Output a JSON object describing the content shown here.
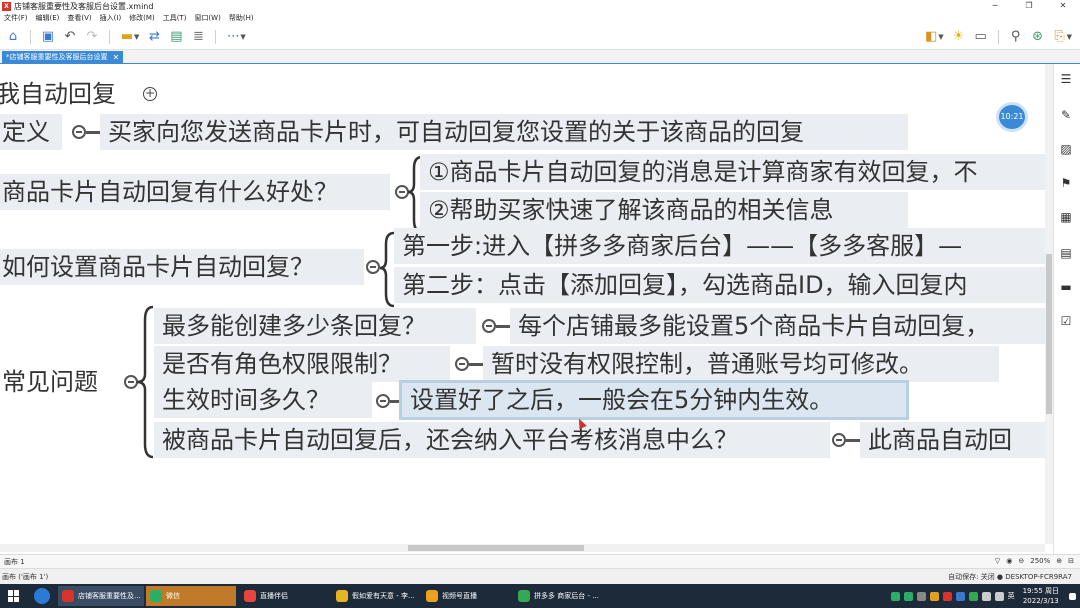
{
  "window": {
    "title": "店铺客服重要性及客服后台设置.xmind",
    "logo": "X",
    "controls": [
      "─",
      "❐",
      "✕"
    ]
  },
  "menu": [
    "文件(F)",
    "编辑(E)",
    "查看(V)",
    "插入(I)",
    "修改(M)",
    "工具(T)",
    "窗口(W)",
    "帮助(H)"
  ],
  "tab": {
    "label": "*店铺客服重要性及客服后台设置",
    "close": "✕"
  },
  "mindmap": {
    "t_header": "我自动回复",
    "t_definition": "定义",
    "t_definition_detail": "买家向您发送商品卡片时，可自动回复您设置的关于该商品的回复",
    "t_benefit": "商品卡片自动回复有什么好处？",
    "t_benefit_1": "①商品卡片自动回复的消息是计算商家有效回复，不",
    "t_benefit_2": "②帮助买家快速了解该商品的相关信息",
    "t_howto": "如何设置商品卡片自动回复？",
    "t_step_1": "第一步:进入【拼多多商家后台】——【多多客服】—",
    "t_step_2": "第二步：点击【添加回复】，勾选商品ID，输入回复内",
    "t_faq": "常见问题",
    "t_faq_q1": "最多能创建多少条回复？",
    "t_faq_a1": "每个店铺最多能设置5个商品卡片自动回复，",
    "t_faq_q2": "是否有角色权限限制？",
    "t_faq_a2": "暂时没有权限控制，普通账号均可修改。",
    "t_faq_q3": "生效时间多久？",
    "t_faq_a3": "设置好了之后，一般会在5分钟内生效。",
    "t_faq_q4": "被商品卡片自动回复后，还会纳入平台考核消息中么？",
    "t_faq_a4": "此商品自动回"
  },
  "time_badge": "10:21",
  "status": {
    "sheet": "画布 1",
    "zoom": "250%"
  },
  "info": {
    "left": "画布 ('画布 1')",
    "right": "自动保存: 关闭  ● DESKTOP-FCR9RA7"
  },
  "taskbar": {
    "items": [
      {
        "label": "店铺客服重要性及...",
        "color": "#d9342b"
      },
      {
        "label": "微信",
        "color": "#2aae67"
      },
      {
        "label": "直播伴侣",
        "color": "#e8453c"
      },
      {
        "label": "假如爱有天意 - 李...",
        "color": "#e6b422"
      },
      {
        "label": "视频号直播",
        "color": "#f0a020"
      },
      {
        "label": "拼多多 商家后台 - ...",
        "color": "#35a853"
      }
    ],
    "ime": "英",
    "time": "19:55 周日",
    "date": "2022/3/13"
  }
}
